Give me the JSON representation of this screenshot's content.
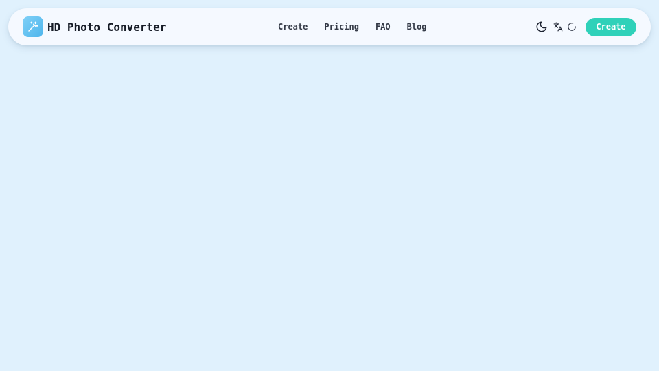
{
  "brand": {
    "name": "HD Photo Converter",
    "logo_icon": "magic-wand-icon",
    "logo_color": "#5bbdf0"
  },
  "nav": {
    "links": [
      {
        "label": "Create"
      },
      {
        "label": "Pricing"
      },
      {
        "label": "FAQ"
      },
      {
        "label": "Blog"
      }
    ]
  },
  "actions": {
    "theme_icon": "moon-icon",
    "language_icon": "translate-icon",
    "status_icon": "loading-spinner-icon",
    "create_label": "Create",
    "create_color": "#2fd1b9"
  },
  "colors": {
    "background": "#e0f1fd",
    "navbar": "#f5f9ff",
    "text": "#161b26"
  }
}
